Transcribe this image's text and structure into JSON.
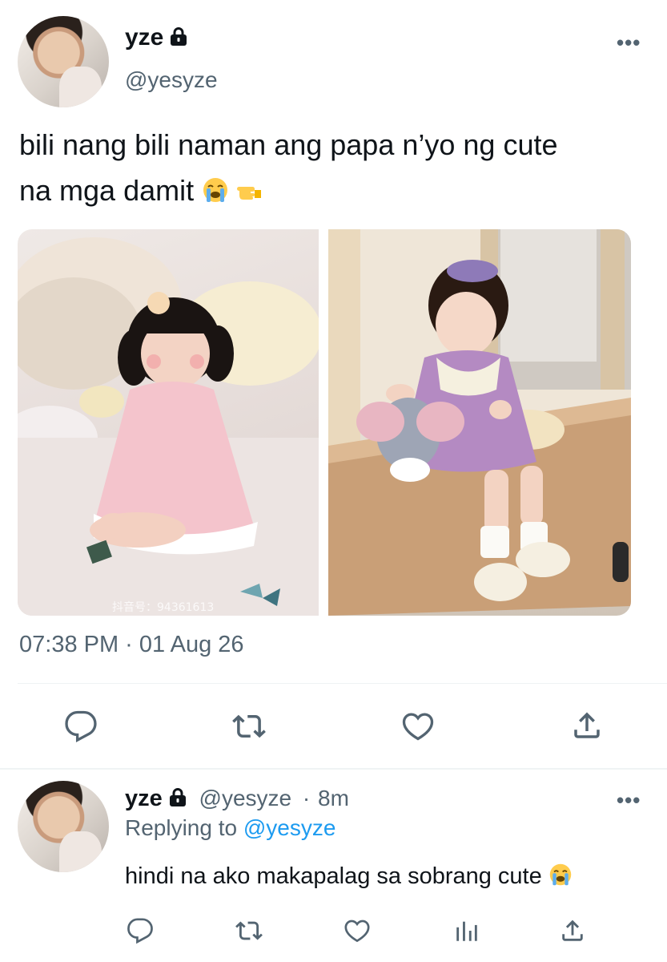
{
  "tweet": {
    "author_name": "yze",
    "author_handle": "@yesyze",
    "text_line1": "bili nang bili naman ang papa n’yo ng cute",
    "text_line2": "na mga damit",
    "emojis": [
      "loudly-crying-face",
      "backhand-index-pointing-left"
    ],
    "timestamp": "07:38 PM · 01 Aug 26",
    "watermark": "抖音号：94361613",
    "actions": [
      "reply",
      "retweet",
      "like",
      "share"
    ]
  },
  "reply": {
    "author_name": "yze",
    "author_handle": "@yesyze",
    "separator": "·",
    "age": "8m",
    "replying_prefix": "Replying to",
    "replying_handle": "@yesyze",
    "text": "hindi na ako makapalag sa sobrang cute",
    "emoji": "loudly-crying-face",
    "actions": [
      "reply",
      "retweet",
      "like",
      "analytics",
      "share"
    ]
  },
  "colors": {
    "text_primary": "#0f1419",
    "text_secondary": "#536471",
    "link": "#1d9bf0",
    "divider": "#eff3f4"
  }
}
